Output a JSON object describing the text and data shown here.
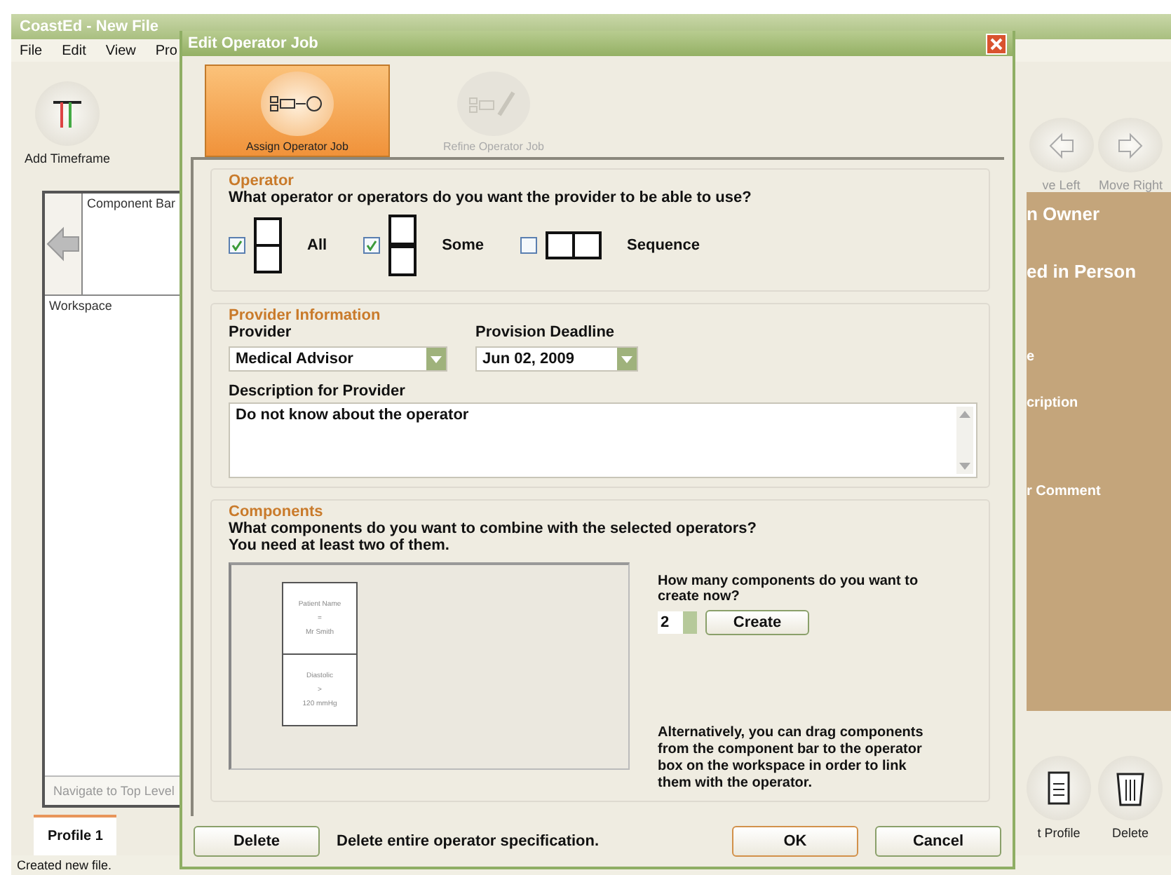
{
  "app": {
    "title": "CoastEd - New File",
    "menu": [
      "File",
      "Edit",
      "View",
      "Pro"
    ],
    "left_toolbar": {
      "label": "Add Timeframe"
    },
    "component_bar": {
      "label": "Component Bar"
    },
    "workspace": {
      "label": "Workspace"
    },
    "navigate": "Navigate to Top Level",
    "profile_tabs": [
      {
        "label": "Profile 1",
        "selected": true
      }
    ],
    "right_toolbar": [
      {
        "label": "ve Left",
        "kind": "left"
      },
      {
        "label": "Move Right",
        "kind": "right"
      }
    ],
    "details": [
      "n Owner",
      "ed in Person",
      "e",
      "cription",
      "r Comment"
    ],
    "bottom_toolbar": [
      {
        "label": "t Profile",
        "kind": "profile"
      },
      {
        "label": "Delete",
        "kind": "trash"
      }
    ],
    "status_bar": "Created new file."
  },
  "dialog": {
    "title": "Edit Operator Job",
    "tabs": [
      {
        "label": "Assign Operator Job",
        "kind": "assign",
        "selected": true,
        "disabled": false
      },
      {
        "label": "Refine Operator Job",
        "kind": "refine",
        "selected": false,
        "disabled": true
      }
    ],
    "operator": {
      "heading": "Operator",
      "question": "What operator or operators do you want the provider to be able to use?",
      "options": [
        {
          "label": "All",
          "kind": "all",
          "checked": true
        },
        {
          "label": "Some",
          "kind": "some",
          "checked": true
        },
        {
          "label": "Sequence",
          "kind": "sequence",
          "checked": false
        }
      ]
    },
    "provider": {
      "heading": "Provider Information",
      "provider_label": "Provider",
      "provider_value": "Medical Advisor",
      "deadline_label": "Provision Deadline",
      "deadline_value": "Jun 02, 2009",
      "description_label": "Description for Provider",
      "description_value": "Do not know about the operator"
    },
    "components": {
      "heading": "Components",
      "question": "What components do you want to combine with the selected operators?",
      "hint": "You need at least two of them.",
      "cards": [
        [
          "Patient Name",
          "=",
          "Mr Smith"
        ],
        [
          "Diastolic",
          ">",
          "120 mmHg"
        ]
      ],
      "count_question": "How many components do you want to create now?",
      "count": "2",
      "create": "Create",
      "alternative": "Alternatively, you can drag components from the component bar to the operator box on the workspace in order to link them with the operator."
    },
    "footer": {
      "delete": "Delete",
      "delete_note": "Delete entire operator specification.",
      "ok": "OK",
      "cancel": "Cancel"
    }
  }
}
